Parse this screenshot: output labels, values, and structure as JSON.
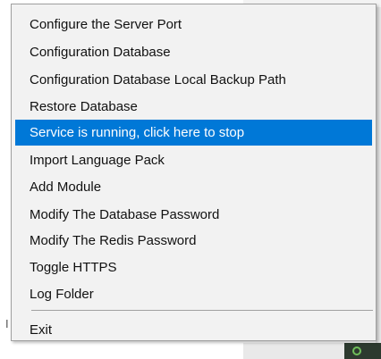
{
  "menu": {
    "items": [
      {
        "label": "Configure the Server Port"
      },
      {
        "label": "Configuration Database"
      },
      {
        "label": "Configuration Database Local Backup Path"
      },
      {
        "label": "Restore Database"
      },
      {
        "label": "Service is running, click here to stop"
      },
      {
        "label": "Import Language Pack"
      },
      {
        "label": "Add Module"
      },
      {
        "label": "Modify The Database Password"
      },
      {
        "label": "Modify The Redis Password"
      },
      {
        "label": "Toggle HTTPS"
      },
      {
        "label": "Log Folder"
      },
      {
        "label": "Exit"
      }
    ],
    "highlight_color": "#0078d7"
  },
  "background": {
    "left_fragment": "I"
  }
}
